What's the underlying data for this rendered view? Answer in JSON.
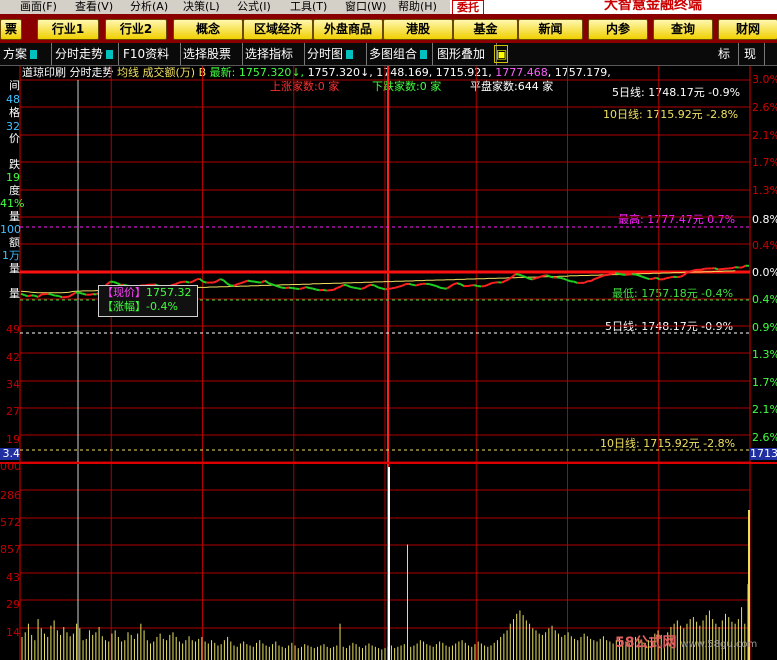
{
  "menu": {
    "items": [
      "画面(F)",
      "查看(V)",
      "分析(A)",
      "决策(L)",
      "公式(I)",
      "工具(T)",
      "窗口(W)",
      "帮助(H)"
    ],
    "brand_tag": "委托",
    "brand_title": "大智慧金融终端"
  },
  "buttons": [
    "行业1",
    "行业2",
    "概念",
    "区域经济",
    "外盘商品",
    "港股",
    "基金",
    "新闻",
    "内参",
    "查询",
    "财网"
  ],
  "left_stub_button": "票",
  "tabs": [
    "方案",
    "分时走势",
    "F10资料",
    "选择股票",
    "选择指标",
    "分时图",
    "多图组合",
    "图形叠加"
  ],
  "right_tabs": [
    "标",
    "现"
  ],
  "info": {
    "index_name": "道琼印刷",
    "chart_name": "分时走势",
    "indicators": "均线 成交额(万) B",
    "latest_label": "最新:",
    "latest_value": "1757.320",
    "v2": "1757.320",
    "v3": "1748.169",
    "v4": "1715.921",
    "v5": "1777.468",
    "v6": "1757.179"
  },
  "stats": {
    "up_count": "上涨家数:0 家",
    "down_count": "下跌家数:0 家",
    "flat_count": "平盘家数:644 家"
  },
  "ma_labels": {
    "ma5_top": "5日线:  1748.17元   -0.9%",
    "ma10_top": "10日线:  1715.92元   -2.8%",
    "high": "最高: 1777.47元  0.7%",
    "low": "最低: 1757.18元  -0.4%",
    "ma5_mid": "5日线:  1748.17元   -0.9%",
    "ma10_bottom": "10日线:  1715.92元  -2.8%"
  },
  "tooltip": {
    "price_label": "【现价】",
    "price_value": "1757.32",
    "change_label": "【涨幅】",
    "change_value": "-0.4%"
  },
  "left_axis": {
    "labels": [
      "间",
      "48",
      "格",
      "32",
      "价",
      "跌",
      "19",
      "度",
      "41%",
      "量",
      "100",
      "额",
      "1万",
      "量",
      "量"
    ],
    "price_ticks": [
      "49",
      "42",
      "34",
      "27",
      "19"
    ],
    "current_tag": "3.4",
    "vol_ticks": [
      "000",
      "286",
      "572",
      "857",
      "43",
      "29",
      "14"
    ]
  },
  "right_axis": {
    "pct_ticks": [
      "3.0%",
      "2.6%",
      "2.1%",
      "1.7%",
      "1.3%",
      "0.8%",
      "0.4%",
      "0.0%",
      "0.4%",
      "0.9%",
      "1.3%",
      "1.7%",
      "2.1%",
      "2.6%"
    ],
    "current_tag": "1713"
  },
  "watermark": {
    "logo": "58公式网",
    "url": "www.58gu.com"
  },
  "colors": {
    "grid_red": "#b00000",
    "up_line": "#ff2020",
    "down_line": "#20d020",
    "avg_line": "#f0e060",
    "volume_bar": "#e8e060",
    "high_label": "#ff20ff",
    "low_label": "#40e040",
    "stats_up": "#ff3030",
    "stats_down": "#40ff40"
  },
  "chart_data": {
    "type": "line",
    "series": [
      {
        "values": [
          1757.6,
          1757.2,
          1756.8,
          1757.1,
          1757.0,
          1756.6,
          1757.4,
          1757.5,
          1757.6,
          1757.3,
          1757.0,
          1756.9,
          1756.5,
          1756.6,
          1756.7,
          1757.4,
          1758.0,
          1757.9,
          1757.6,
          1757.3,
          1757.3,
          1757.5,
          1757.4,
          1758.3,
          1759.4,
          1760.5,
          1761.4,
          1761.3,
          1760.9,
          1760.4,
          1760.4,
          1760.1,
          1759.9,
          1759.5,
          1759.9,
          1760.2,
          1760.2,
          1760.4,
          1760.4,
          1760.5,
          1760.1,
          1759.7,
          1759.6,
          1759.9,
          1760.3,
          1760.6,
          1761.1,
          1761.3,
          1761.4,
          1761.1,
          1761.4,
          1762.0,
          1762.3,
          1761.4,
          1761.1,
          1761.1,
          1761.1,
          1761.5,
          1762.2,
          1761.8,
          1760.8,
          1760.2,
          1760.1,
          1760.6,
          1760.9,
          1761.3,
          1761.7,
          1761.5,
          1761.4,
          1761.2,
          1761.1,
          1761.7,
          1761.0,
          1760.6,
          1760.2,
          1759.8,
          1759.5,
          1759.4,
          1759.5,
          1759.4,
          1759.2,
          1759.1,
          1759.3,
          1759.7,
          1759.4,
          1759.2,
          1758.9,
          1758.7,
          1758.8,
          1758.6,
          1758.7,
          1758.8,
          1759.4,
          1759.8,
          1760.4,
          1760.2,
          1759.7,
          1759.5,
          1759.3,
          1759.1,
          1759.4,
          1760.1,
          1760.4,
          1760.2,
          1759.6,
          1759.3,
          1759.0,
          1759.1,
          1759.3,
          1759.5,
          1759.8,
          1760.1,
          1760.6,
          1760.7,
          1760.4,
          1760.2,
          1760.5,
          1760.7,
          1760.7,
          1760.6,
          1760.3,
          1760.0,
          1759.5,
          1759.3,
          1759.2,
          1759.9,
          1760.6,
          1760.9,
          1760.6,
          1760.0,
          1760.0,
          1760.2,
          1760.3,
          1760.0,
          1759.9,
          1760.0,
          1760.4,
          1760.9,
          1761.1,
          1761.2,
          1761.1,
          1761.6,
          1762.1,
          1762.9,
          1763.7,
          1763.6,
          1763.2,
          1762.8,
          1762.3,
          1762.1,
          1762.5,
          1762.8,
          1763.2,
          1763.4,
          1763.0,
          1762.7,
          1762.7,
          1762.6,
          1762.3,
          1761.9,
          1761.5,
          1761.4,
          1761.0,
          1761.0,
          1761.0,
          1761.5,
          1761.6,
          1762.2,
          1762.6,
          1763.0,
          1763.4,
          1763.5,
          1763.9,
          1764.0,
          1763.9,
          1763.6,
          1763.5,
          1763.6,
          1763.7,
          1763.6,
          1763.3,
          1762.9,
          1762.5,
          1762.2,
          1762.3,
          1762.6,
          1762.1,
          1762.1,
          1762.5,
          1762.7,
          1762.9,
          1762.8,
          1762.9,
          1763.4,
          1764.3,
          1764.6,
          1764.9,
          1765.1,
          1765.1,
          1765.4,
          1765.5,
          1765.5,
          1765.6,
          1765.2,
          1765.3,
          1765.4,
          1765.5,
          1765.6,
          1765.9,
          1765.8,
          1765.8,
          1766.4,
          1766.3
        ]
      },
      {
        "values": [
          1758.4,
          1758.3,
          1758.2,
          1758.1,
          1758.0,
          1757.9,
          1757.9,
          1757.9,
          1757.9,
          1757.9,
          1757.9,
          1757.9,
          1757.9,
          1758.0,
          1758.1,
          1758.3,
          1758.4,
          1758.4,
          1758.5,
          1758.5,
          1758.5,
          1758.5,
          1758.6,
          1758.6,
          1758.6,
          1758.7,
          1758.7,
          1758.7,
          1758.8,
          1758.8,
          1758.8,
          1758.9,
          1758.9,
          1758.9,
          1759.0,
          1759.0,
          1759.0,
          1759.1,
          1759.1,
          1759.1,
          1759.2,
          1759.2,
          1759.2,
          1759.3,
          1759.3,
          1759.3,
          1759.4,
          1759.4,
          1759.4,
          1759.5,
          1759.5,
          1759.5,
          1759.6,
          1759.6,
          1759.6,
          1759.7,
          1759.7,
          1759.7,
          1759.8,
          1759.8,
          1759.8,
          1759.9,
          1759.9,
          1759.9,
          1760.0,
          1760.0,
          1760.0,
          1760.1,
          1760.1,
          1760.1,
          1760.2,
          1760.2,
          1760.2,
          1760.3,
          1760.3,
          1760.3,
          1760.4,
          1760.4,
          1760.4,
          1760.5,
          1760.5,
          1760.5,
          1760.6,
          1760.6,
          1760.6,
          1760.7,
          1760.7,
          1760.7,
          1760.8,
          1760.8,
          1760.8,
          1760.9,
          1760.9,
          1760.9,
          1761.0,
          1761.0,
          1761.0,
          1761.1,
          1761.1,
          1761.1,
          1761.2,
          1761.2,
          1761.2,
          1761.3,
          1761.3,
          1761.3,
          1761.4,
          1761.4,
          1761.4,
          1761.5,
          1761.5,
          1761.5,
          1761.6,
          1761.6,
          1761.6,
          1761.7,
          1761.7,
          1761.7,
          1761.8,
          1761.8,
          1761.8,
          1761.9,
          1761.9,
          1761.9,
          1762.0,
          1762.0,
          1762.0,
          1762.1,
          1762.1,
          1762.1,
          1762.2,
          1762.2,
          1762.2,
          1762.3,
          1762.3,
          1762.3,
          1762.4,
          1762.4,
          1762.4,
          1762.5,
          1762.5,
          1762.5,
          1762.6,
          1762.6,
          1762.6,
          1762.7,
          1762.7,
          1762.7,
          1762.8,
          1762.8,
          1762.8,
          1762.9,
          1762.9,
          1762.9,
          1763.0,
          1763.0,
          1763.0,
          1763.1,
          1763.1,
          1763.1,
          1763.2,
          1763.2,
          1763.2,
          1763.3,
          1763.3,
          1763.3,
          1763.4,
          1763.4,
          1763.4,
          1763.5,
          1763.5,
          1763.5,
          1763.6,
          1763.6,
          1763.6,
          1763.7,
          1763.7,
          1763.7,
          1763.8,
          1763.8,
          1763.8,
          1763.9,
          1763.9,
          1763.9,
          1764.0,
          1764.0,
          1764.0,
          1764.1,
          1764.1,
          1764.1,
          1764.2,
          1764.2,
          1764.2,
          1764.3,
          1764.3,
          1764.3,
          1764.4,
          1764.4,
          1764.4,
          1764.5,
          1764.5,
          1764.5,
          1764.6,
          1764.6,
          1764.6,
          1764.7,
          1764.7,
          1764.7,
          1764.8
        ]
      }
    ],
    "prev_close": 1764.4,
    "high": 1777.47,
    "low": 1757.18,
    "ma5": 1748.17,
    "ma10": 1715.92,
    "volume_ticks": [
      "000",
      "286",
      "572",
      "857",
      "43",
      "29",
      "14"
    ],
    "volume": [
      0.35,
      0.42,
      0.55,
      0.38,
      0.3,
      0.62,
      0.48,
      0.4,
      0.35,
      0.52,
      0.6,
      0.45,
      0.38,
      0.5,
      0.42,
      0.36,
      0.4,
      0.55,
      0.48,
      0.3,
      0.32,
      0.45,
      0.38,
      0.42,
      0.5,
      0.36,
      0.3,
      0.28,
      0.4,
      0.45,
      0.35,
      0.28,
      0.3,
      0.42,
      0.38,
      0.32,
      0.4,
      0.55,
      0.45,
      0.3,
      0.25,
      0.28,
      0.35,
      0.4,
      0.32,
      0.3,
      0.38,
      0.42,
      0.35,
      0.28,
      0.25,
      0.3,
      0.36,
      0.3,
      0.28,
      0.32,
      0.35,
      0.28,
      0.25,
      0.3,
      0.26,
      0.22,
      0.24,
      0.3,
      0.35,
      0.28,
      0.22,
      0.2,
      0.25,
      0.28,
      0.24,
      0.22,
      0.2,
      0.26,
      0.3,
      0.25,
      0.22,
      0.2,
      0.24,
      0.28,
      0.22,
      0.2,
      0.18,
      0.22,
      0.26,
      0.22,
      0.18,
      0.2,
      0.24,
      0.22,
      0.2,
      0.18,
      0.2,
      0.22,
      0.24,
      0.2,
      0.18,
      0.2,
      0.22,
      0.55,
      0.2,
      0.18,
      0.22,
      0.26,
      0.24,
      0.2,
      0.18,
      0.22,
      0.25,
      0.22,
      0.2,
      0.18,
      0.16,
      0.18,
      0.2,
      0.22,
      0.18,
      0.2,
      0.22,
      0.24,
      1.75,
      0.2,
      0.22,
      0.25,
      0.3,
      0.28,
      0.24,
      0.22,
      0.2,
      0.24,
      0.28,
      0.26,
      0.22,
      0.2,
      0.22,
      0.25,
      0.28,
      0.3,
      0.26,
      0.22,
      0.2,
      0.24,
      0.28,
      0.25,
      0.22,
      0.2,
      0.22,
      0.26,
      0.3,
      0.35,
      0.4,
      0.45,
      0.55,
      0.62,
      0.7,
      0.75,
      0.68,
      0.6,
      0.55,
      0.48,
      0.45,
      0.4,
      0.38,
      0.42,
      0.48,
      0.52,
      0.45,
      0.4,
      0.35,
      0.38,
      0.42,
      0.36,
      0.32,
      0.3,
      0.35,
      0.4,
      0.36,
      0.32,
      0.3,
      0.28,
      0.32,
      0.36,
      0.3,
      0.28,
      0.25,
      0.3,
      0.34,
      0.3,
      0.28,
      0.26,
      0.3,
      0.35,
      0.32,
      0.28,
      0.26,
      0.3,
      0.35,
      0.4,
      0.45,
      0.38,
      0.35,
      0.42,
      0.5,
      0.55,
      0.6,
      0.52,
      0.48,
      0.55,
      0.62,
      0.65,
      0.58,
      0.52,
      0.6,
      0.68,
      0.75,
      0.62,
      0.55,
      0.5,
      0.6,
      0.7,
      0.65,
      0.58,
      0.55,
      0.62,
      0.8,
      0.55,
      1.15
    ]
  }
}
